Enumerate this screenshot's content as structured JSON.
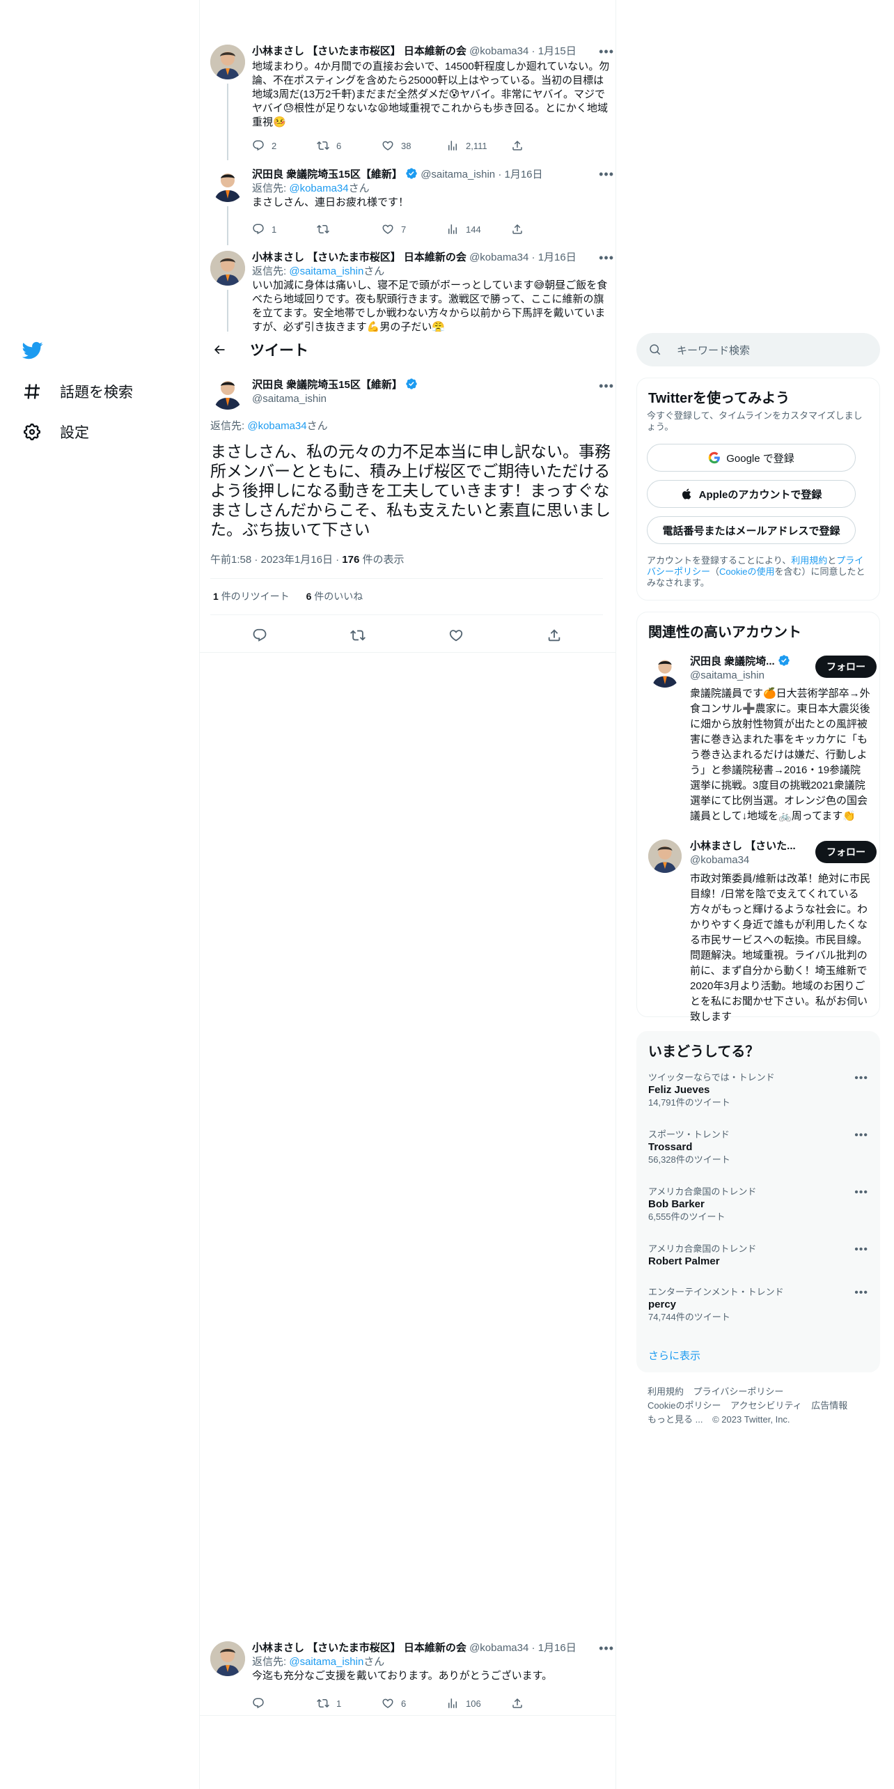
{
  "nav": {
    "explore_label": "話題を検索",
    "settings_label": "設定"
  },
  "thread": [
    {
      "name": "小林まさし 【さいたま市桜区】 日本維新の会",
      "handle": "@kobama34",
      "date": "1月15日",
      "text": "地域まわり。4か月間での直接お会いで、14500軒程度しか廻れていない。勿論、不在ポスティングを含めたら25000軒以上はやっている。当初の目標は地域3周だ(13万2千軒)まだまだ全然ダメだ😰ヤバイ。非常にヤバイ。マジでヤバイ😓根性が足りないな😫地域重視でこれからも歩き回る。とにかく地域重視🤒",
      "replies": "2",
      "retweets": "6",
      "likes": "38",
      "views": "2,111"
    },
    {
      "name": "沢田良 衆議院埼玉15区【維新】",
      "handle": "@saitama_ishin",
      "date": "1月16日",
      "reply_prefix": "返信先: ",
      "reply_to": "@kobama34",
      "reply_suffix": "さん",
      "text": "まさしさん、連日お疲れ様です！",
      "replies": "1",
      "retweets": "",
      "likes": "7",
      "views": "144"
    },
    {
      "name": "小林まさし 【さいたま市桜区】 日本維新の会",
      "handle": "@kobama34",
      "date": "1月16日",
      "reply_prefix": "返信先: ",
      "reply_to": "@saitama_ishin",
      "reply_suffix": "さん",
      "text": "いい加減に身体は痛いし、寝不足で頭がボーっとしています😅朝昼ご飯を食べたら地域回りです。夜も駅頭行きます。激戦区で勝って、ここに維新の旗を立てます。安全地帯でしか戦わない方々から以前から下馬評を戴いていますが、必ず引き抜きます💪男の子だい😤"
    }
  ],
  "header": {
    "title": "ツイート"
  },
  "main_tweet": {
    "name": "沢田良 衆議院埼玉15区【維新】",
    "handle": "@saitama_ishin",
    "reply_prefix": "返信先: ",
    "reply_to": "@kobama34",
    "reply_suffix": "さん",
    "text": "まさしさん、私の元々の力不足本当に申し訳ない。事務所メンバーとともに、積み上げ桜区でご期待いただけるよう後押しになる動きを工夫していきます！まっすぐなまさしさんだからこそ、私も支えたいと素直に思いました。ぶち抜いて下さい",
    "time": "午前1:58",
    "date": "2023年1月16日",
    "views_count": "176",
    "views_label": "件の表示",
    "retweet_count": "1",
    "retweet_label": "件のリツイート",
    "like_count": "6",
    "like_label": "件のいいね"
  },
  "bottom_reply": {
    "name": "小林まさし 【さいたま市桜区】 日本維新の会",
    "handle": "@kobama34",
    "date": "1月16日",
    "reply_prefix": "返信先: ",
    "reply_to": "@saitama_ishin",
    "reply_suffix": "さん",
    "text": "今迄も充分なご支援を戴いております。ありがとうございます。",
    "replies": "",
    "retweets": "1",
    "likes": "6",
    "views": "106"
  },
  "search": {
    "placeholder": "キーワード検索"
  },
  "signup": {
    "title": "Twitterを使ってみよう",
    "subtitle": "今すぐ登録して、タイムラインをカスタマイズしましょう。",
    "google_label": "Google で登録",
    "apple_label": "Appleのアカウントで登録",
    "phone_label": "電話番号またはメールアドレスで登録",
    "legal_1": "アカウントを登録することにより、",
    "legal_terms": "利用規約",
    "legal_2": "と",
    "legal_privacy": "プライバシーポリシー",
    "legal_3": "（",
    "legal_cookie": "Cookieの使用",
    "legal_4": "を含む）に同意したとみなされます。"
  },
  "relevant": {
    "title": "関連性の高いアカウント",
    "follow_label": "フォロー",
    "accounts": [
      {
        "name": "沢田良 衆議院埼...",
        "handle": "@saitama_ishin",
        "bio": "衆議院議員です🍊日大芸術学部卒→外食コンサル➕農家に。東日本大震災後に畑から放射性物質が出たとの風評被害に巻き込まれた事をキッカケに「もう巻き込まれるだけは嫌だ、行動しよう」と参議院秘書→2016・19参議院選挙に挑戦。3度目の挑戦2021衆議院選挙にて比例当選。オレンジ色の国会議員として↓地域を🚲周ってます👏"
      },
      {
        "name": "小林まさし 【さいた...",
        "handle": "@kobama34",
        "bio": "市政対策委員/維新は改革！絶対に市民目線！/日常を陰で支えてくれている方々がもっと輝けるような社会に。わかりやすく身近で誰もが利用したくなる市民サービスへの転換。市民目線。問題解決。地域重視。ライバル批判の前に、まず自分から動く！埼玉維新で2020年3月より活動。地域のお困りごとを私にお聞かせ下さい。私がお伺い致します"
      }
    ]
  },
  "trends": {
    "title": "いまどうしてる？",
    "items": [
      {
        "category": "ツイッターならでは・トレンド",
        "name": "Feliz Jueves",
        "count": "14,791件のツイート"
      },
      {
        "category": "スポーツ・トレンド",
        "name": "Trossard",
        "count": "56,328件のツイート"
      },
      {
        "category": "アメリカ合衆国のトレンド",
        "name": "Bob Barker",
        "count": "6,555件のツイート"
      },
      {
        "category": "アメリカ合衆国のトレンド",
        "name": "Robert Palmer",
        "count": ""
      },
      {
        "category": "エンターテインメント・トレンド",
        "name": "percy",
        "count": "74,744件のツイート"
      }
    ],
    "show_more": "さらに表示"
  },
  "footer": {
    "terms": "利用規約",
    "privacy": "プライバシーポリシー",
    "cookie": "Cookieのポリシー",
    "accessibility": "アクセシビリティ",
    "ads": "広告情報",
    "more": "もっと見る ...",
    "copyright": "© 2023 Twitter, Inc."
  },
  "colors": {
    "accent": "#1d9bf0",
    "text": "#0f1419",
    "muted": "#536471"
  }
}
